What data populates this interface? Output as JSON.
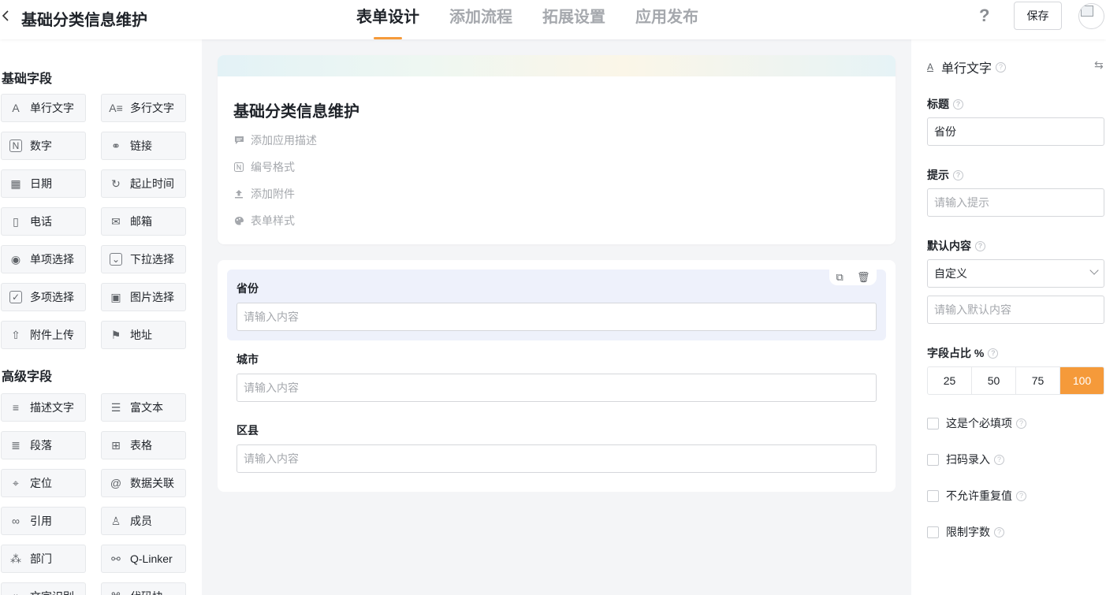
{
  "header": {
    "back_icon": "chevron-left-icon",
    "title": "基础分类信息维护",
    "tabs": [
      {
        "label": "表单设计",
        "active": true
      },
      {
        "label": "添加流程",
        "active": false
      },
      {
        "label": "拓展设置",
        "active": false
      },
      {
        "label": "应用发布",
        "active": false
      }
    ],
    "help": "?",
    "save_label": "保存",
    "accent": "#f59a3a"
  },
  "left": {
    "basic_title": "基础字段",
    "basic_fields": [
      {
        "label": "单行文字",
        "icon": "A"
      },
      {
        "label": "多行文字",
        "icon": "A≡"
      },
      {
        "label": "数字",
        "icon": "N"
      },
      {
        "label": "链接",
        "icon": "⚭"
      },
      {
        "label": "日期",
        "icon": "▦"
      },
      {
        "label": "起止时间",
        "icon": "↻"
      },
      {
        "label": "电话",
        "icon": "▯"
      },
      {
        "label": "邮箱",
        "icon": "✉"
      },
      {
        "label": "单项选择",
        "icon": "◉"
      },
      {
        "label": "下拉选择",
        "icon": "⌄"
      },
      {
        "label": "多项选择",
        "icon": "✓"
      },
      {
        "label": "图片选择",
        "icon": "▣"
      },
      {
        "label": "附件上传",
        "icon": "⇧"
      },
      {
        "label": "地址",
        "icon": "⚑"
      }
    ],
    "advanced_title": "高级字段",
    "advanced_fields": [
      {
        "label": "描述文字",
        "icon": "≡"
      },
      {
        "label": "富文本",
        "icon": "☰"
      },
      {
        "label": "段落",
        "icon": "≣"
      },
      {
        "label": "表格",
        "icon": "⊞"
      },
      {
        "label": "定位",
        "icon": "⌖"
      },
      {
        "label": "数据关联",
        "icon": "@"
      },
      {
        "label": "引用",
        "icon": "∞"
      },
      {
        "label": "成员",
        "icon": "♙"
      },
      {
        "label": "部门",
        "icon": "⁂"
      },
      {
        "label": "Q-Linker",
        "icon": "⚯"
      },
      {
        "label": "文字识别",
        "icon": "⌗"
      },
      {
        "label": "代码块",
        "icon": "⌘"
      }
    ]
  },
  "form": {
    "title": "基础分类信息维护",
    "meta": [
      {
        "label": "添加应用描述",
        "icon": "comment-icon"
      },
      {
        "label": "编号格式",
        "icon": "number-icon"
      },
      {
        "label": "添加附件",
        "icon": "upload-icon"
      },
      {
        "label": "表单样式",
        "icon": "palette-icon"
      }
    ],
    "fields": [
      {
        "label": "省份",
        "placeholder": "请输入内容",
        "selected": true
      },
      {
        "label": "城市",
        "placeholder": "请输入内容",
        "selected": false
      },
      {
        "label": "区县",
        "placeholder": "请输入内容",
        "selected": false
      }
    ]
  },
  "props": {
    "type_label": "单行文字",
    "title_label": "标题",
    "title_value": "省份",
    "hint_label": "提示",
    "hint_placeholder": "请输入提示",
    "default_label": "默认内容",
    "default_select": "自定义",
    "default_placeholder": "请输入默认内容",
    "ratio_label": "字段占比 %",
    "ratio_options": [
      "25",
      "50",
      "75",
      "100"
    ],
    "ratio_selected": "100",
    "checks": [
      {
        "label": "这是个必填项",
        "checked": false
      },
      {
        "label": "扫码录入",
        "checked": false
      },
      {
        "label": "不允许重复值",
        "checked": false
      },
      {
        "label": "限制字数",
        "checked": false
      }
    ]
  }
}
